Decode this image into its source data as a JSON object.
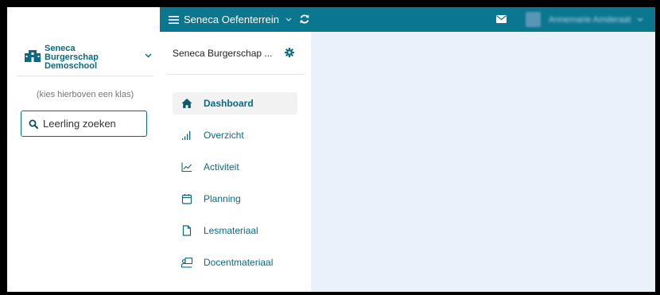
{
  "colors": {
    "brand": "#0a7690",
    "text_accent": "#0a6a80",
    "main_background": "#e9f2fb"
  },
  "sidebar": {
    "school_name": "Seneca\nBurgerschap\nDemoschool",
    "school_icon": "school-building-icon",
    "class_hint": "(kies hierboven een klas)",
    "search_placeholder": "Leerling zoeken"
  },
  "topbar": {
    "environment_label": "Seneca Oefenterrein",
    "user_name": "Annemarie Amderaat"
  },
  "nav": {
    "course_title": "Seneca Burgerschap ...",
    "items": [
      {
        "label": "Dashboard",
        "icon": "home-icon",
        "active": true
      },
      {
        "label": "Overzicht",
        "icon": "signal-bars-icon",
        "active": false
      },
      {
        "label": "Activiteit",
        "icon": "line-chart-icon",
        "active": false
      },
      {
        "label": "Planning",
        "icon": "calendar-icon",
        "active": false
      },
      {
        "label": "Lesmateriaal",
        "icon": "document-icon",
        "active": false
      },
      {
        "label": "Docentmateriaal",
        "icon": "teacher-icon",
        "active": false
      }
    ]
  }
}
